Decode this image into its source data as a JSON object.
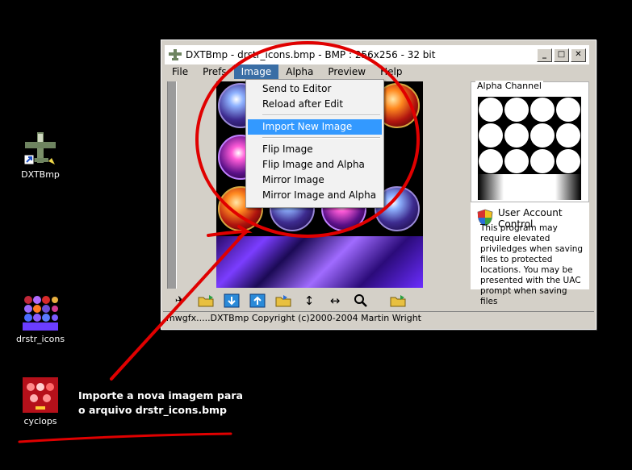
{
  "desktop": {
    "icons": [
      {
        "label": "DXTBmp",
        "icon": "dxtbmp-airplane-icon"
      },
      {
        "label": "drstr_icons",
        "icon": "image-thumbnail-icon"
      },
      {
        "label": "cyclops",
        "icon": "image-thumbnail-icon"
      }
    ]
  },
  "window": {
    "title": "DXTBmp - drstr_icons.bmp - BMP : 256x256 - 32 bit",
    "buttons": {
      "minimize": "_",
      "maximize": "□",
      "close": "✕"
    },
    "menu": [
      {
        "label": "File"
      },
      {
        "label": "Prefs"
      },
      {
        "label": "Image",
        "active": true
      },
      {
        "label": "Alpha"
      },
      {
        "label": "Preview"
      },
      {
        "label": "Help"
      }
    ],
    "image_menu": {
      "items": [
        {
          "label": "Send to Editor"
        },
        {
          "label": "Reload after Edit"
        },
        {
          "label": "Import New Image",
          "highlighted": true
        },
        {
          "label": "Flip Image"
        },
        {
          "label": "Flip Image and Alpha"
        },
        {
          "label": "Mirror Image"
        },
        {
          "label": "Mirror Image and Alpha"
        }
      ]
    },
    "alpha_panel": {
      "label": "Alpha Channel"
    },
    "uac": {
      "title": "User Account Control",
      "text": "This program may require elevated priviledges when saving files to protected locations. You may be presented with the UAC prompt when saving files"
    },
    "toolbar": [
      "airplane-icon",
      "open-folder-icon",
      "import-icon",
      "export-icon",
      "folder-arrow-icon",
      "flip-vertical-icon",
      "flip-horizontal-icon",
      "zoom-icon",
      "folder-icon"
    ],
    "status": "mwgfx.....DXTBmp Copyright (c)2000-2004 Martin Wright"
  },
  "annotation": {
    "text": "Importe a nova imagem para o arquivo drstr_icons.bmp",
    "color": "#e00000"
  }
}
